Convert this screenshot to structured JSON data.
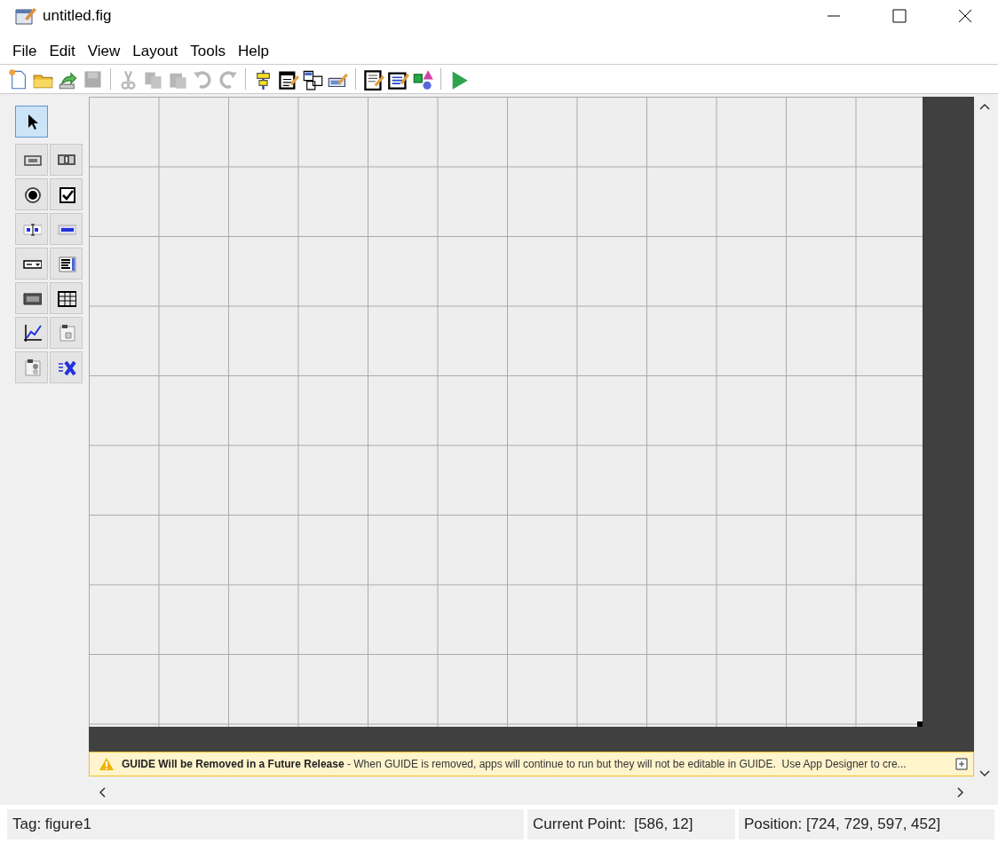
{
  "window": {
    "title": "untitled.fig"
  },
  "menu": [
    "File",
    "Edit",
    "View",
    "Layout",
    "Tools",
    "Help"
  ],
  "toolbar": [
    {
      "kind": "new",
      "disabled": false
    },
    {
      "kind": "open",
      "disabled": false
    },
    {
      "kind": "export",
      "disabled": false
    },
    {
      "kind": "save",
      "disabled": true
    },
    {
      "kind": "separator"
    },
    {
      "kind": "cut",
      "disabled": true
    },
    {
      "kind": "copy",
      "disabled": true
    },
    {
      "kind": "paste",
      "disabled": true
    },
    {
      "kind": "undo",
      "disabled": true
    },
    {
      "kind": "redo",
      "disabled": true
    },
    {
      "kind": "separator"
    },
    {
      "kind": "align",
      "disabled": false
    },
    {
      "kind": "menu-editor",
      "disabled": false
    },
    {
      "kind": "tab-order",
      "disabled": false
    },
    {
      "kind": "toolbar-editor",
      "disabled": false
    },
    {
      "kind": "separator"
    },
    {
      "kind": "editor",
      "disabled": false
    },
    {
      "kind": "inspector",
      "disabled": false
    },
    {
      "kind": "browser",
      "disabled": false
    },
    {
      "kind": "separator"
    },
    {
      "kind": "run",
      "disabled": false
    }
  ],
  "palette": [
    {
      "kind": "select",
      "selected": true
    },
    {
      "kind": "push-button",
      "selected": false
    },
    {
      "kind": "slider",
      "selected": false
    },
    {
      "kind": "radio",
      "selected": false
    },
    {
      "kind": "checkbox",
      "selected": false
    },
    {
      "kind": "edit-text",
      "selected": false
    },
    {
      "kind": "static-text",
      "selected": false
    },
    {
      "kind": "popup",
      "selected": false
    },
    {
      "kind": "listbox",
      "selected": false
    },
    {
      "kind": "toggle",
      "selected": false
    },
    {
      "kind": "table",
      "selected": false
    },
    {
      "kind": "axes",
      "selected": false
    },
    {
      "kind": "panel",
      "selected": false
    },
    {
      "kind": "button-group",
      "selected": false
    },
    {
      "kind": "activex",
      "selected": false
    }
  ],
  "banner": {
    "text": "**GUIDE Will be Removed in a Future Release** - When GUIDE is removed, apps will continue to run but they will not be editable in GUIDE.  Use App Designer to cre..."
  },
  "status_bar": {
    "tag": "Tag: figure1",
    "current_point": "Current Point:  [586, 12]",
    "position": "Position: [724, 729, 597, 452]"
  }
}
